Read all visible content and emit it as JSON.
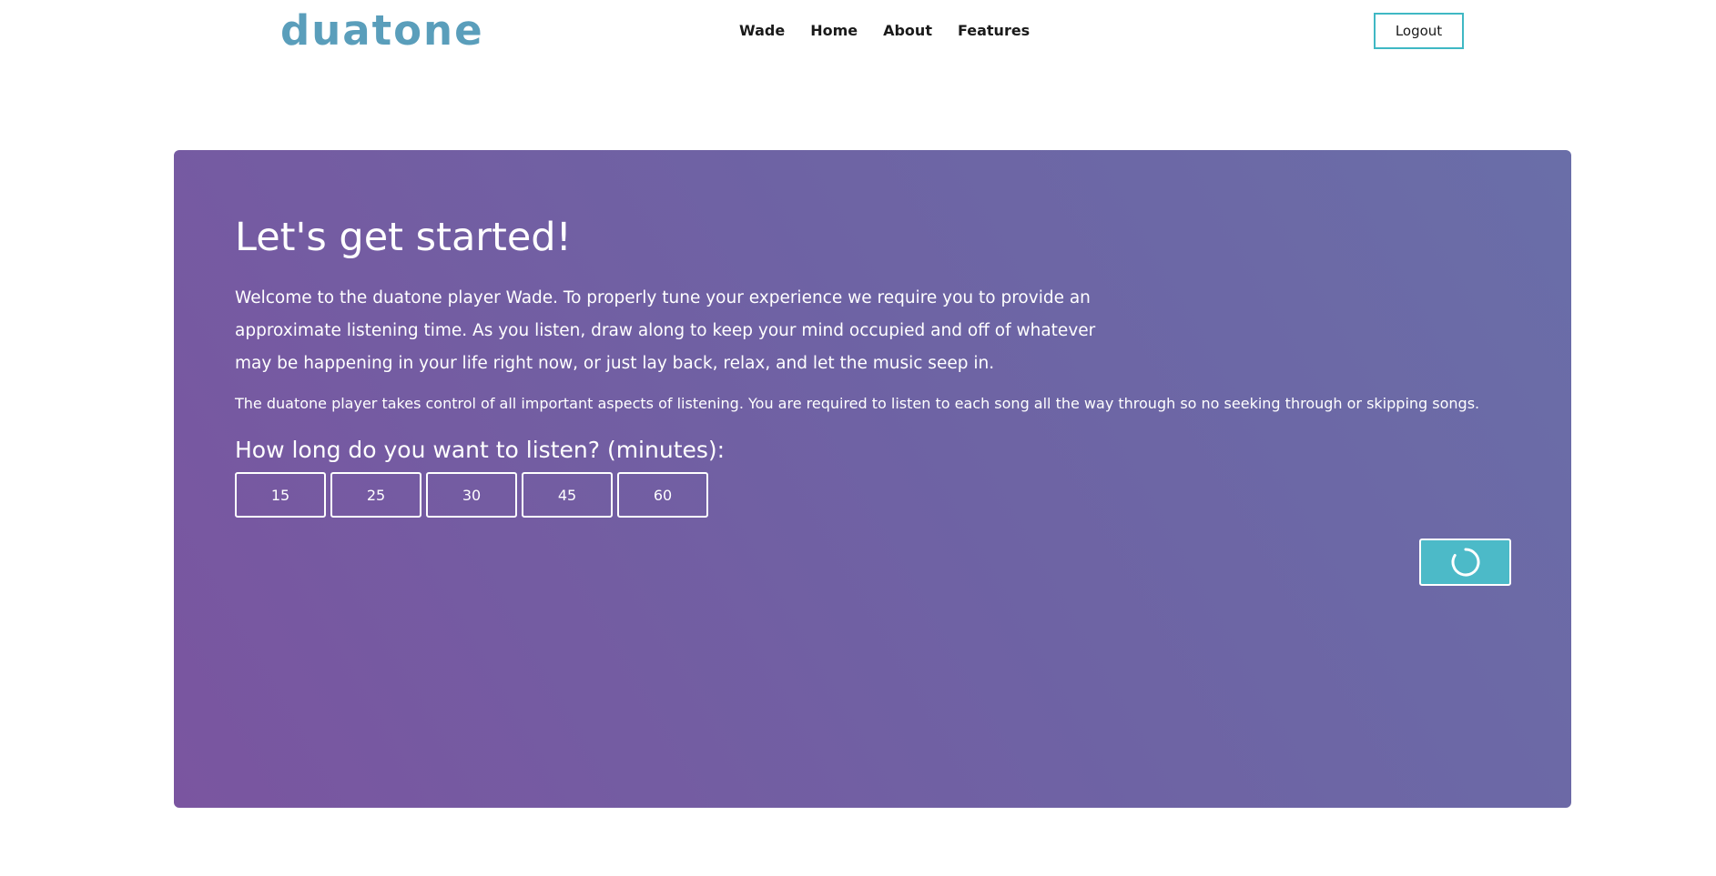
{
  "header": {
    "logo_text": "duatone",
    "nav": [
      {
        "label": "Wade"
      },
      {
        "label": "Home"
      },
      {
        "label": "About"
      },
      {
        "label": "Features"
      }
    ],
    "logout_label": "Logout"
  },
  "main": {
    "title": "Let's get started!",
    "intro": "Welcome to the duatone player Wade. To properly tune your experience we require you to provide an approximate listening time. As you listen, draw along to keep your mind occupied and off of whatever may be happening in your life right now, or just lay back, relax, and let the music seep in.",
    "notice": "The duatone player takes control of all important aspects of listening. You are required to listen to each song all the way through so no seeking through or skipping songs.",
    "question": "How long do you want to listen? (minutes):",
    "options": [
      {
        "label": "15"
      },
      {
        "label": "25"
      },
      {
        "label": "30"
      },
      {
        "label": "45"
      },
      {
        "label": "60"
      }
    ],
    "start_button_icon": "loading-spinner-icon"
  },
  "colors": {
    "brand": "#5a9ebb",
    "accent": "#4cbac8",
    "card_start": "#7a55a0",
    "card_end": "#6a6ea8"
  }
}
